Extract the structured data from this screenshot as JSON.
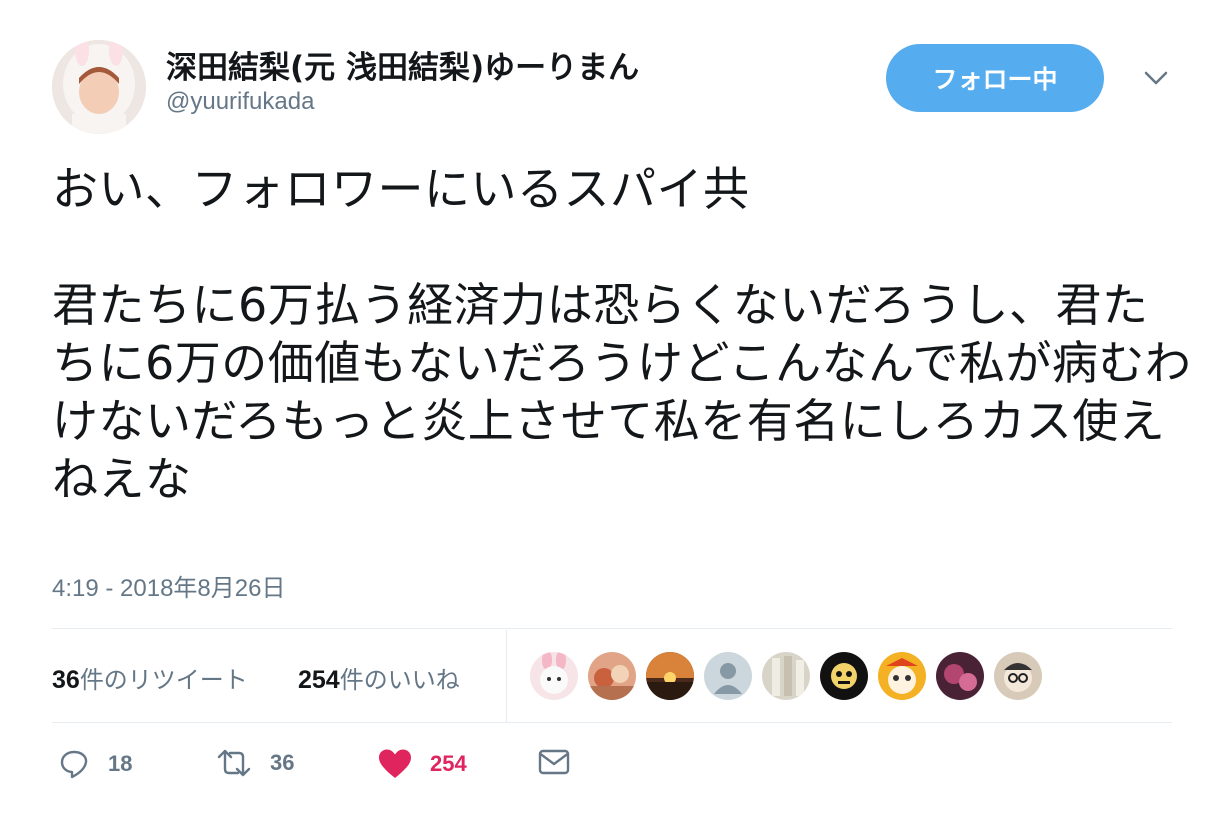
{
  "header": {
    "display_name": "深田結梨(元 浅田結梨)ゆーりまん",
    "handle": "@yuurifukada",
    "follow_label": "フォロー中"
  },
  "tweet": {
    "text": "おい、フォロワーにいるスパイ共\n\n君たちに6万払う経済力は恐らくないだろうし、君たちに6万の価値もないだろうけどこんなんで私が病むわけないだろもっと炎上させて私を有名にしろカス使えねえな",
    "timestamp": "4:19 - 2018年8月26日"
  },
  "stats": {
    "retweets_count": "36",
    "retweets_label": "件のリツイート",
    "likes_count": "254",
    "likes_label": "件のいいね"
  },
  "likers": [
    {
      "icon": "bunny-avatar",
      "color": "#f3d6dc"
    },
    {
      "icon": "food-avatar",
      "color": "#d98c6a"
    },
    {
      "icon": "sunset-avatar",
      "color": "#c46a2a"
    },
    {
      "icon": "default-avatar",
      "color": "#ccd6dd"
    },
    {
      "icon": "glass-avatar",
      "color": "#d7d2c6"
    },
    {
      "icon": "skull-avatar",
      "color": "#111111"
    },
    {
      "icon": "cartoon-avatar",
      "color": "#f5b021"
    },
    {
      "icon": "dark-pink-avatar",
      "color": "#8a3a5a"
    },
    {
      "icon": "face-avatar",
      "color": "#c9b9a4"
    }
  ],
  "actions": {
    "reply_count": "18",
    "retweet_count": "36",
    "like_count": "254"
  },
  "colors": {
    "accent": "#55acee",
    "like": "#e0245e",
    "secondary_text": "#657786",
    "divider": "#e6ecf0"
  }
}
